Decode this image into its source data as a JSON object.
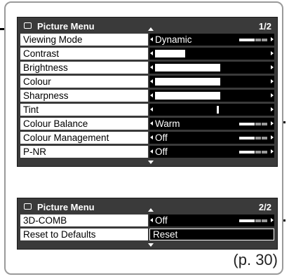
{
  "panel1": {
    "title": "Picture Menu",
    "page": "1/2",
    "rows": [
      {
        "label": "Viewing Mode",
        "kind": "text",
        "value": "Dynamic",
        "scale": true
      },
      {
        "label": "Contrast",
        "kind": "bar",
        "level": 0.24
      },
      {
        "label": "Brightness",
        "kind": "bar",
        "level": 0.52
      },
      {
        "label": "Colour",
        "kind": "bar",
        "level": 0.52
      },
      {
        "label": "Sharpness",
        "kind": "bar",
        "level": 0.52
      },
      {
        "label": "Tint",
        "kind": "tint",
        "level": 0.5
      },
      {
        "label": "Colour Balance",
        "kind": "text",
        "value": "Warm",
        "scale": true
      },
      {
        "label": "Colour Management",
        "kind": "text",
        "value": "Off",
        "scale": true
      },
      {
        "label": "P-NR",
        "kind": "text",
        "value": "Off",
        "scale": true
      }
    ]
  },
  "panel2": {
    "title": "Picture Menu",
    "page": "2/2",
    "rows": [
      {
        "label": "3D-COMB",
        "kind": "text",
        "value": "Off",
        "scale": true
      },
      {
        "label": "Reset to Defaults",
        "kind": "reset",
        "value": "Reset"
      }
    ]
  },
  "page_reference": "(p. 30)"
}
